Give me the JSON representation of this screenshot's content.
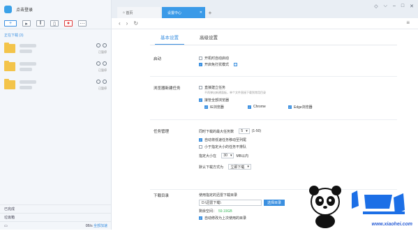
{
  "left": {
    "login_text": "点击登录",
    "section_label": "正在下载 (3)",
    "items": [
      {
        "status": "已暂停"
      },
      {
        "status": "已暂停"
      },
      {
        "status": "已暂停"
      }
    ],
    "bottom": {
      "completed": "已完成",
      "trash": "垃圾箱",
      "speed": "0B/s",
      "speed_link": "全部加速"
    }
  },
  "tabs": [
    {
      "label": "首页",
      "active": false
    },
    {
      "label": "设置中心",
      "active": true
    }
  ],
  "subtabs": {
    "basic": "基本设置",
    "advanced": "高级设置"
  },
  "settings": {
    "startup": {
      "title": "启动",
      "opt1": "开机时自动启动",
      "opt2": "开启免打扰模式",
      "info_badge": "!"
    },
    "browser": {
      "title": "浏览器新建任务",
      "opt1": "直接建立任务",
      "hint": "不再弹出新建面板，单个文件直接下载到常用目录",
      "opt2": "接管全部浏览器",
      "b1": "IE浏览器",
      "b2": "Chrome",
      "b3": "Edge浏览器"
    },
    "task": {
      "title": "任务管理",
      "max_label": "同时下载的最大任务数",
      "max_value": "5",
      "max_range": "(1-50)",
      "opt1": "自动将低速任务移动至列尾",
      "opt2": "小于指定大小的任务不排队",
      "size_label": "指定大小在",
      "size_value": "30",
      "size_unit": "MB以内",
      "mode_label": "默认下载方式为",
      "mode_value": "立即下载"
    },
    "download_dir": {
      "title": "下载目录",
      "label": "使用指定的迅雷下载目录",
      "path": "D:\\迅雷下载\\",
      "choose_btn": "选择目录",
      "free_label": "剩余空间：",
      "free_value": "59.19GB",
      "opt1": "自动修改为上次使用的目录"
    }
  },
  "watermark": {
    "url": "www.xiaohei.com"
  },
  "colors": {
    "accent": "#3a8fe0",
    "folder": "#f3c44a",
    "tab_active": "#3a9ae8"
  }
}
